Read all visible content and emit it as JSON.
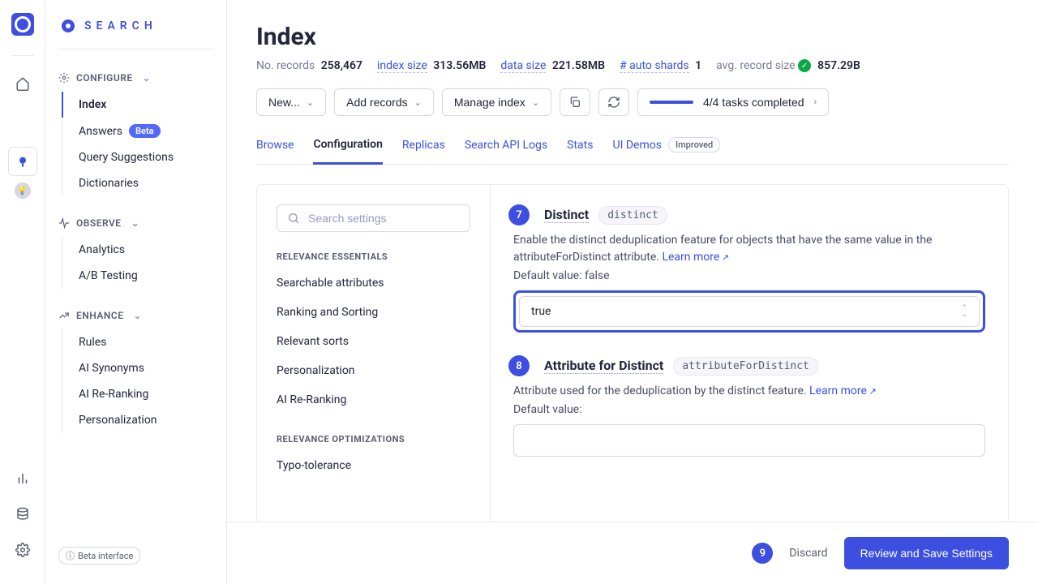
{
  "brand": {
    "search_label": "SEARCH"
  },
  "sidebar": {
    "groups": [
      {
        "name": "CONFIGURE",
        "items": [
          {
            "label": "Index",
            "active": true
          },
          {
            "label": "Answers",
            "badge": "Beta"
          },
          {
            "label": "Query Suggestions"
          },
          {
            "label": "Dictionaries"
          }
        ]
      },
      {
        "name": "OBSERVE",
        "items": [
          {
            "label": "Analytics"
          },
          {
            "label": "A/B Testing"
          }
        ]
      },
      {
        "name": "ENHANCE",
        "items": [
          {
            "label": "Rules"
          },
          {
            "label": "AI Synonyms"
          },
          {
            "label": "AI Re-Ranking"
          },
          {
            "label": "Personalization"
          }
        ]
      }
    ],
    "beta_interface": "Beta interface"
  },
  "header": {
    "title": "Index",
    "stats": {
      "records_label": "No. records",
      "records_value": "258,467",
      "index_size_label": "index size",
      "index_size_value": "313.56MB",
      "data_size_label": "data size",
      "data_size_value": "221.58MB",
      "shards_label": "# auto shards",
      "shards_value": "1",
      "avg_label": "avg. record size",
      "avg_value": "857.29B"
    },
    "toolbar": {
      "new_label": "New...",
      "add_records": "Add records",
      "manage_index": "Manage index",
      "tasks": "4/4 tasks completed"
    }
  },
  "tabs": {
    "browse": "Browse",
    "configuration": "Configuration",
    "replicas": "Replicas",
    "search_api_logs": "Search API Logs",
    "stats": "Stats",
    "ui_demos": "UI Demos",
    "improved": "Improved"
  },
  "config": {
    "search_placeholder": "Search settings",
    "cat1": "RELEVANCE ESSENTIALS",
    "cat1_items": [
      "Searchable attributes",
      "Ranking and Sorting",
      "Relevant sorts",
      "Personalization",
      "AI Re-Ranking"
    ],
    "cat2": "RELEVANCE OPTIMIZATIONS",
    "cat2_items": [
      "Typo-tolerance"
    ]
  },
  "settings": {
    "distinct": {
      "num": "7",
      "title": "Distinct",
      "code": "distinct",
      "desc": "Enable the distinct deduplication feature for objects that have the same value in the attributeForDistinct attribute.",
      "learn_more": "Learn more",
      "default_label": "Default value: false",
      "value": "true"
    },
    "attr": {
      "num": "8",
      "title": "Attribute for Distinct",
      "code": "attributeForDistinct",
      "desc": "Attribute used for the deduplication by the distinct feature.",
      "learn_more": "Learn more",
      "default_label": "Default value:"
    }
  },
  "footer": {
    "num": "9",
    "discard": "Discard",
    "save": "Review and Save Settings"
  }
}
